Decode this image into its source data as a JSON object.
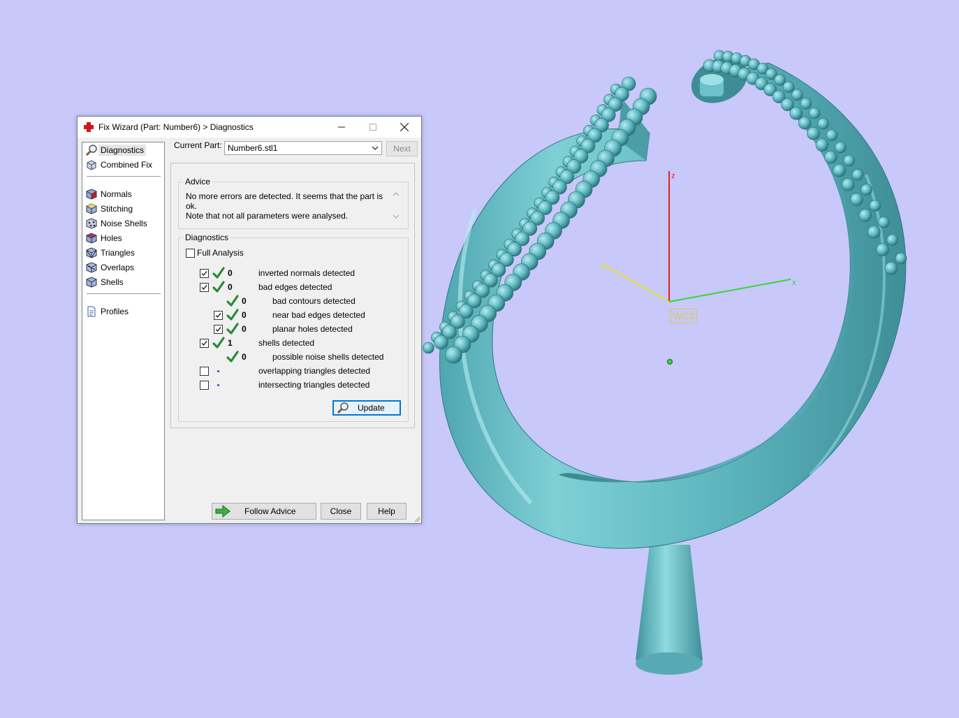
{
  "window": {
    "title": "Fix Wizard (Part: Number6) > Diagnostics"
  },
  "tree": {
    "items": [
      {
        "label": "Diagnostics",
        "icon": "magnifier-icon",
        "selected": true
      },
      {
        "label": "Combined Fix",
        "icon": "combined-fix-icon"
      },
      {
        "label": "Normals",
        "icon": "normals-cube-icon"
      },
      {
        "label": "Stitching",
        "icon": "stitching-cube-icon"
      },
      {
        "label": "Noise Shells",
        "icon": "noise-shells-cube-icon"
      },
      {
        "label": "Holes",
        "icon": "holes-cube-icon"
      },
      {
        "label": "Triangles",
        "icon": "triangles-cube-icon"
      },
      {
        "label": "Overlaps",
        "icon": "overlaps-cube-icon"
      },
      {
        "label": "Shells",
        "icon": "shells-cube-icon"
      },
      {
        "label": "Profiles",
        "icon": "profiles-document-icon"
      }
    ]
  },
  "part": {
    "label": "Current Part:",
    "value": "Number6.stl1",
    "next_label": "Next"
  },
  "advice": {
    "title": "Advice",
    "line1": "No more errors are detected. It seems that the part is ok.",
    "line2": "Note that not all parameters were analysed."
  },
  "diagnostics": {
    "title": "Diagnostics",
    "full_analysis_label": "Full Analysis",
    "full_analysis_checked": false,
    "rows": [
      {
        "count": "0",
        "text": "inverted normals detected"
      },
      {
        "count": "0",
        "text": "bad edges detected"
      },
      {
        "count": "0",
        "text": "bad contours detected"
      },
      {
        "count": "0",
        "text": "near bad edges detected"
      },
      {
        "count": "0",
        "text": "planar holes detected"
      },
      {
        "count": "1",
        "text": "shells detected"
      },
      {
        "count": "0",
        "text": "possible noise shells detected"
      },
      {
        "count": "",
        "text": "overlapping triangles detected"
      },
      {
        "count": "",
        "text": "intersecting triangles detected"
      }
    ],
    "update_label": "Update"
  },
  "buttons": {
    "follow_advice": "Follow Advice",
    "close": "Close",
    "help": "Help"
  },
  "viewport": {
    "axis_x": "x",
    "axis_y": "y",
    "axis_z": "z",
    "wcs_label": "WCS",
    "background": "#c8c8fa",
    "model_color": "#5fb8c0"
  }
}
